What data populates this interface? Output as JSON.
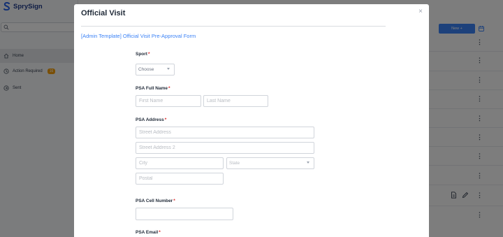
{
  "app": {
    "name": "SprySign",
    "brand_color": "#1e3a8a",
    "accent_color": "#3b82f6"
  },
  "sidebar": {
    "search_icon": "search-icon",
    "items": [
      {
        "label": "Home",
        "icon": "home-icon",
        "active": true
      },
      {
        "label": "Action Required",
        "icon": "clock-icon",
        "badge": "16"
      },
      {
        "label": "Sent",
        "icon": "send-icon"
      }
    ]
  },
  "toolbar": {
    "new_label": "New +"
  },
  "modal": {
    "title": "Official Visit",
    "close_glyph": "×",
    "template_link": "[Admin Template] Official Visit Pre-Approval Form",
    "fields": {
      "sport": {
        "label": "Sport",
        "placeholder": "Choose"
      },
      "psa_full_name": {
        "label": "PSA Full Name",
        "first_placeholder": "First Name",
        "last_placeholder": "Last Name"
      },
      "psa_address": {
        "label": "PSA Address",
        "street_placeholder": "Street Address",
        "street2_placeholder": "Street Address 2",
        "city_placeholder": "City",
        "state_placeholder": "State",
        "postal_placeholder": "Postal"
      },
      "psa_cell": {
        "label": "PSA Cell Number"
      },
      "psa_email": {
        "label": "PSA Email"
      }
    },
    "required_mark": "*"
  }
}
